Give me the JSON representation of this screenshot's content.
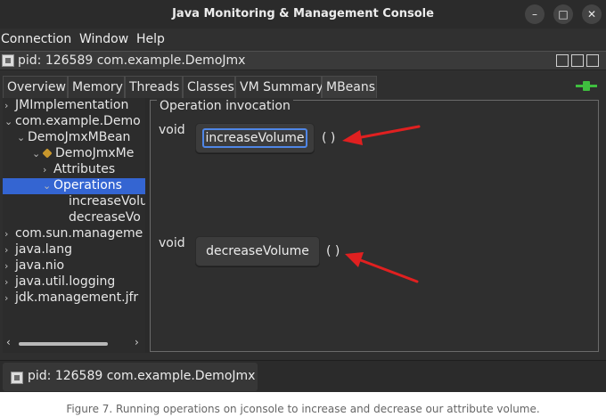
{
  "window": {
    "title": "Java Monitoring & Management Console",
    "controls": {
      "minimize": "–",
      "maximize": "□",
      "close": "✕"
    }
  },
  "menu": {
    "items": [
      "Connection",
      "Window",
      "Help"
    ]
  },
  "frame": {
    "title": "pid: 126589 com.example.DemoJmx"
  },
  "tabs": [
    "Overview",
    "Memory",
    "Threads",
    "Classes",
    "VM Summary",
    "MBeans"
  ],
  "active_tab": "MBeans",
  "tree": {
    "nodes": [
      {
        "label": "JMImplementation",
        "chevron": "›"
      },
      {
        "label": "com.example.Demo",
        "chevron": "⌄"
      },
      {
        "label": "DemoJmxMBean",
        "chevron": "⌄"
      },
      {
        "label": "DemoJmxMe",
        "chevron": "⌄"
      },
      {
        "label": "Attributes",
        "chevron": "›"
      },
      {
        "label": "Operations",
        "chevron": "⌄"
      },
      {
        "label": "increaseVolu",
        "chevron": ""
      },
      {
        "label": "decreaseVo",
        "chevron": ""
      },
      {
        "label": "com.sun.manageme",
        "chevron": "›"
      },
      {
        "label": "java.lang",
        "chevron": "›"
      },
      {
        "label": "java.nio",
        "chevron": "›"
      },
      {
        "label": "java.util.logging",
        "chevron": "›"
      },
      {
        "label": "jdk.management.jfr",
        "chevron": "›"
      }
    ],
    "selected": "Operations",
    "scroll": {
      "left": "‹",
      "right": "›"
    }
  },
  "operations": {
    "legend": "Operation invocation",
    "items": [
      {
        "return_type": "void",
        "name": "increaseVolume",
        "params": "( )"
      },
      {
        "return_type": "void",
        "name": "decreaseVolume",
        "params": "( )"
      }
    ]
  },
  "taskbar": {
    "label": "pid: 126589 com.example.DemoJmx"
  },
  "caption": "Figure 7. Running operations on jconsole to increase and decrease our attribute volume.",
  "colors": {
    "selection": "#3465d2",
    "annotation_arrow": "#e02020",
    "connection_plug": "#3fbf3f"
  },
  "icons": [
    "minimize-icon",
    "maximize-icon",
    "close-icon",
    "frame-icon",
    "plug-icon",
    "chevron-icon",
    "mbean-icon"
  ]
}
